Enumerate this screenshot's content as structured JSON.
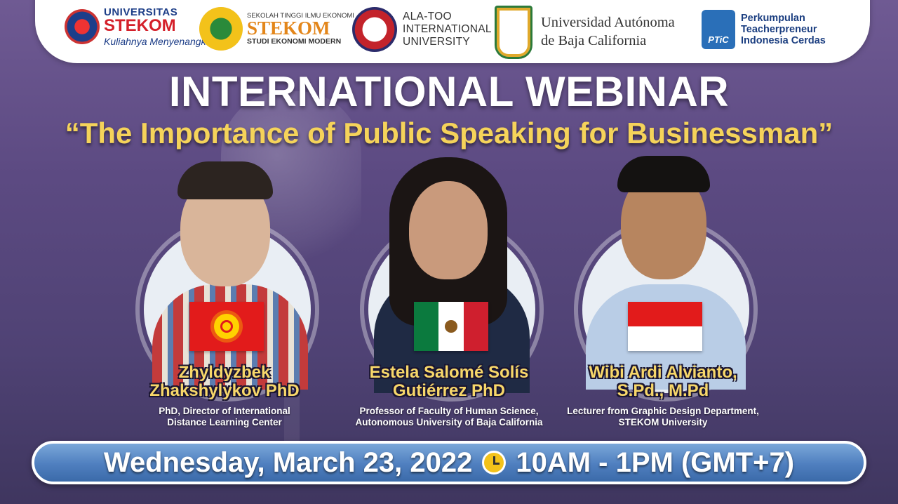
{
  "logos": {
    "stekom_univ": {
      "line1": "UNIVERSITAS",
      "line2": "STEKOM",
      "tagline": "Kuliahnya Menyenangkan !"
    },
    "stekom_sekolah": {
      "line1": "SEKOLAH TINGGI ILMU EKONOMI",
      "line2": "STEKOM",
      "line3": "STUDI EKONOMI MODERN"
    },
    "alatoo": {
      "line1": "ALA-TOO",
      "line2": "INTERNATIONAL",
      "line3": "UNIVERSITY"
    },
    "uabc": {
      "line1": "Universidad Autónoma",
      "line2": "de Baja California"
    },
    "ptic": {
      "badge": "PTiC",
      "line1": "Perkumpulan",
      "line2": "Teacherpreneur",
      "line3": "Indonesia Cerdas"
    }
  },
  "title": "INTERNATIONAL WEBINAR",
  "subtitle": "“The Importance of Public Speaking for Businessman”",
  "speakers": [
    {
      "name_line1": "Zhyldyzbek",
      "name_line2": "Zhakshylykov PhD",
      "role_line1": "PhD, Director of International",
      "role_line2": "Distance Learning Center",
      "flag": "kyrgyzstan-flag"
    },
    {
      "name_line1": "Estela Salomé Solís",
      "name_line2": "Gutiérrez PhD",
      "role_line1": "Professor of Faculty of Human Science,",
      "role_line2": "Autonomous University of Baja California",
      "flag": "mexico-flag"
    },
    {
      "name_line1": "Wibi Ardi Alvianto,",
      "name_line2": "S.Pd., M.Pd",
      "role_line1": "Lecturer from Graphic Design Department,",
      "role_line2": "STEKOM University",
      "flag": "indonesia-flag"
    }
  ],
  "event": {
    "date": "Wednesday, March 23, 2022",
    "time": "10AM - 1PM (GMT+7)",
    "icon": "alarm-clock-icon"
  },
  "colors": {
    "title": "#ffffff",
    "subtitle": "#f5d35a",
    "speaker_name": "#f7d76a",
    "date_bar": "#4f7fbf"
  }
}
